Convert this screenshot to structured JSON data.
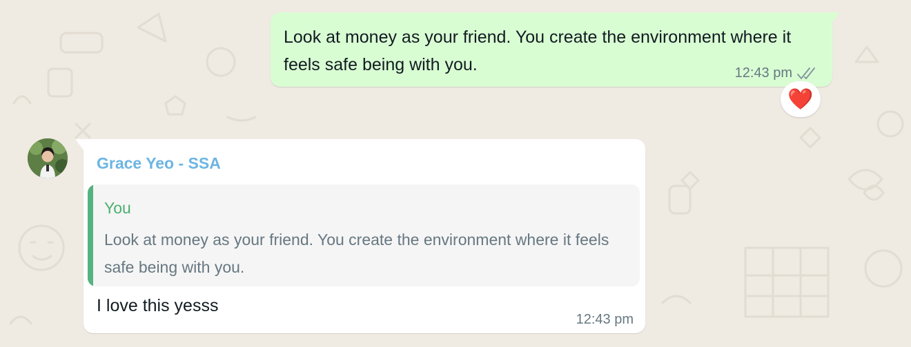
{
  "outgoing": {
    "text": "Look at money as your friend. You create the environment where it feels safe being with you.",
    "time": "12:43 pm",
    "status_icon": "double-check-icon",
    "reaction": "❤️"
  },
  "incoming": {
    "sender": "Grace Yeo - SSA",
    "quote": {
      "author": "You",
      "text": "Look at money as your friend. You create the environment where it feels safe being with you."
    },
    "text": "I love this yesss",
    "time": "12:43 pm"
  },
  "colors": {
    "background": "#efeae2",
    "outgoing_bubble": "#d9fdd3",
    "incoming_bubble": "#ffffff",
    "sender_name": "#6cb5e3",
    "quote_accent": "#56b37f"
  }
}
